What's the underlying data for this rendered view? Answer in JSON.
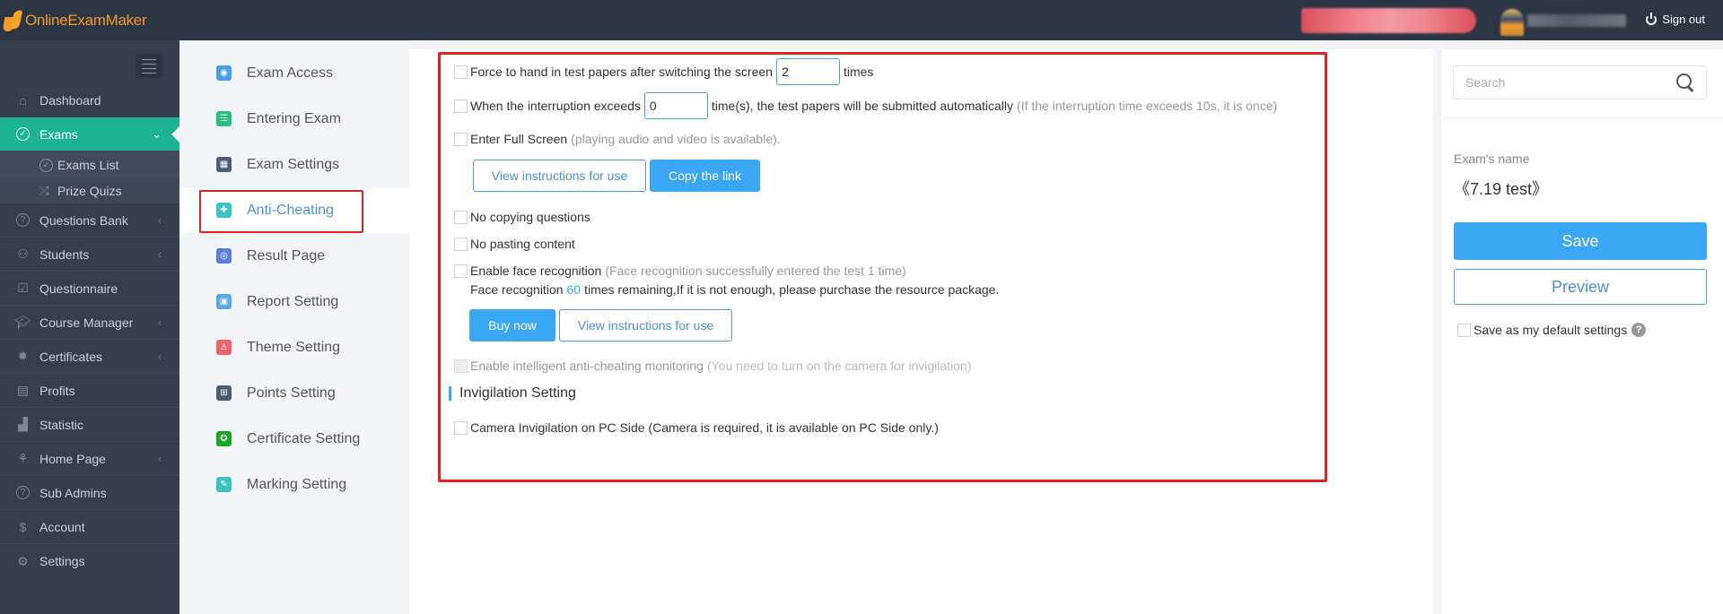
{
  "app": {
    "logo_text": "OnlineExamMaker",
    "sign_out_label": "Sign out"
  },
  "sidebar": {
    "items": [
      {
        "label": "Dashboard",
        "icon": "home-icon"
      },
      {
        "label": "Exams",
        "icon": "check-circle-icon",
        "active": true
      },
      {
        "label": "Questions Bank",
        "icon": "question-circle-icon"
      },
      {
        "label": "Students",
        "icon": "users-icon"
      },
      {
        "label": "Questionnaire",
        "icon": "checkbox-icon"
      },
      {
        "label": "Course Manager",
        "icon": "graduation-cap-icon"
      },
      {
        "label": "Certificates",
        "icon": "badge-icon"
      },
      {
        "label": "Profits",
        "icon": "credit-card-icon"
      },
      {
        "label": "Statistic",
        "icon": "bar-chart-icon"
      },
      {
        "label": "Home Page",
        "icon": "plant-icon"
      },
      {
        "label": "Sub Admins",
        "icon": "question-circle-icon"
      },
      {
        "label": "Account",
        "icon": "dollar-icon"
      },
      {
        "label": "Settings",
        "icon": "gear-icon"
      }
    ],
    "exam_subitems": [
      {
        "label": "Exams List",
        "icon": "check-circle-icon"
      },
      {
        "label": "Prize Quizs",
        "icon": "shuffle-icon"
      }
    ]
  },
  "settings_nav": {
    "items": [
      {
        "label": "Exam Access",
        "color": "#4a9ee8"
      },
      {
        "label": "Entering Exam",
        "color": "#27c07a"
      },
      {
        "label": "Exam Settings",
        "color": "#4b5d72"
      },
      {
        "label": "Anti-Cheating",
        "color": "#3cc4c4",
        "active": true
      },
      {
        "label": "Result Page",
        "color": "#5a7de0"
      },
      {
        "label": "Report Setting",
        "color": "#56a8e8"
      },
      {
        "label": "Theme Setting",
        "color": "#f0636b"
      },
      {
        "label": "Points Setting",
        "color": "#4b5d72"
      },
      {
        "label": "Certificate Setting",
        "color": "#18a822"
      },
      {
        "label": "Marking Setting",
        "color": "#3cc4c4"
      }
    ]
  },
  "anti_cheating": {
    "force_handin": {
      "label": "Force to hand in test papers after switching the screen",
      "value": "2",
      "suffix": "times"
    },
    "interruption": {
      "label": "When the interruption exceeds",
      "value": "0",
      "suffix": "time(s), the test papers will be submitted automatically",
      "note": "(If the interruption time exceeds 10s, it is once)"
    },
    "full_screen": {
      "label": "Enter Full Screen",
      "note": "(playing audio and video is available)."
    },
    "view_instructions_label": "View instructions for use",
    "copy_link_label": "Copy the link",
    "no_copying": {
      "label": "No copying questions"
    },
    "no_pasting": {
      "label": "No pasting content"
    },
    "face_recognition": {
      "label": "Enable face recognition",
      "note": "(Face recognition successfully entered the test 1 time)"
    },
    "face_remaining": {
      "prefix": "Face recognition",
      "count": "60",
      "suffix": "times remaining,If it is not enough, please purchase the resource package."
    },
    "buy_now_label": "Buy now",
    "view_instructions_label_2": "View instructions for use",
    "intelligent_monitoring": {
      "label": "Enable intelligent anti-cheating monitoring",
      "note": "(You need to turn on the camera for invigilation)"
    },
    "invigilation_title": "Invigilation Setting",
    "camera_pc": {
      "label": "Camera Invigilation on PC Side (Camera is required, it is available on PC Side only.)"
    }
  },
  "right_panel": {
    "search_placeholder": "Search",
    "exam_name_label": "Exam's name",
    "exam_name": "《7.19 test》",
    "save_label": "Save",
    "preview_label": "Preview",
    "default_settings_label": "Save as my default settings"
  },
  "colors": {
    "accent": "#3aa7f5",
    "sidebar_active": "#1bb394",
    "highlight_border": "#e02424"
  }
}
